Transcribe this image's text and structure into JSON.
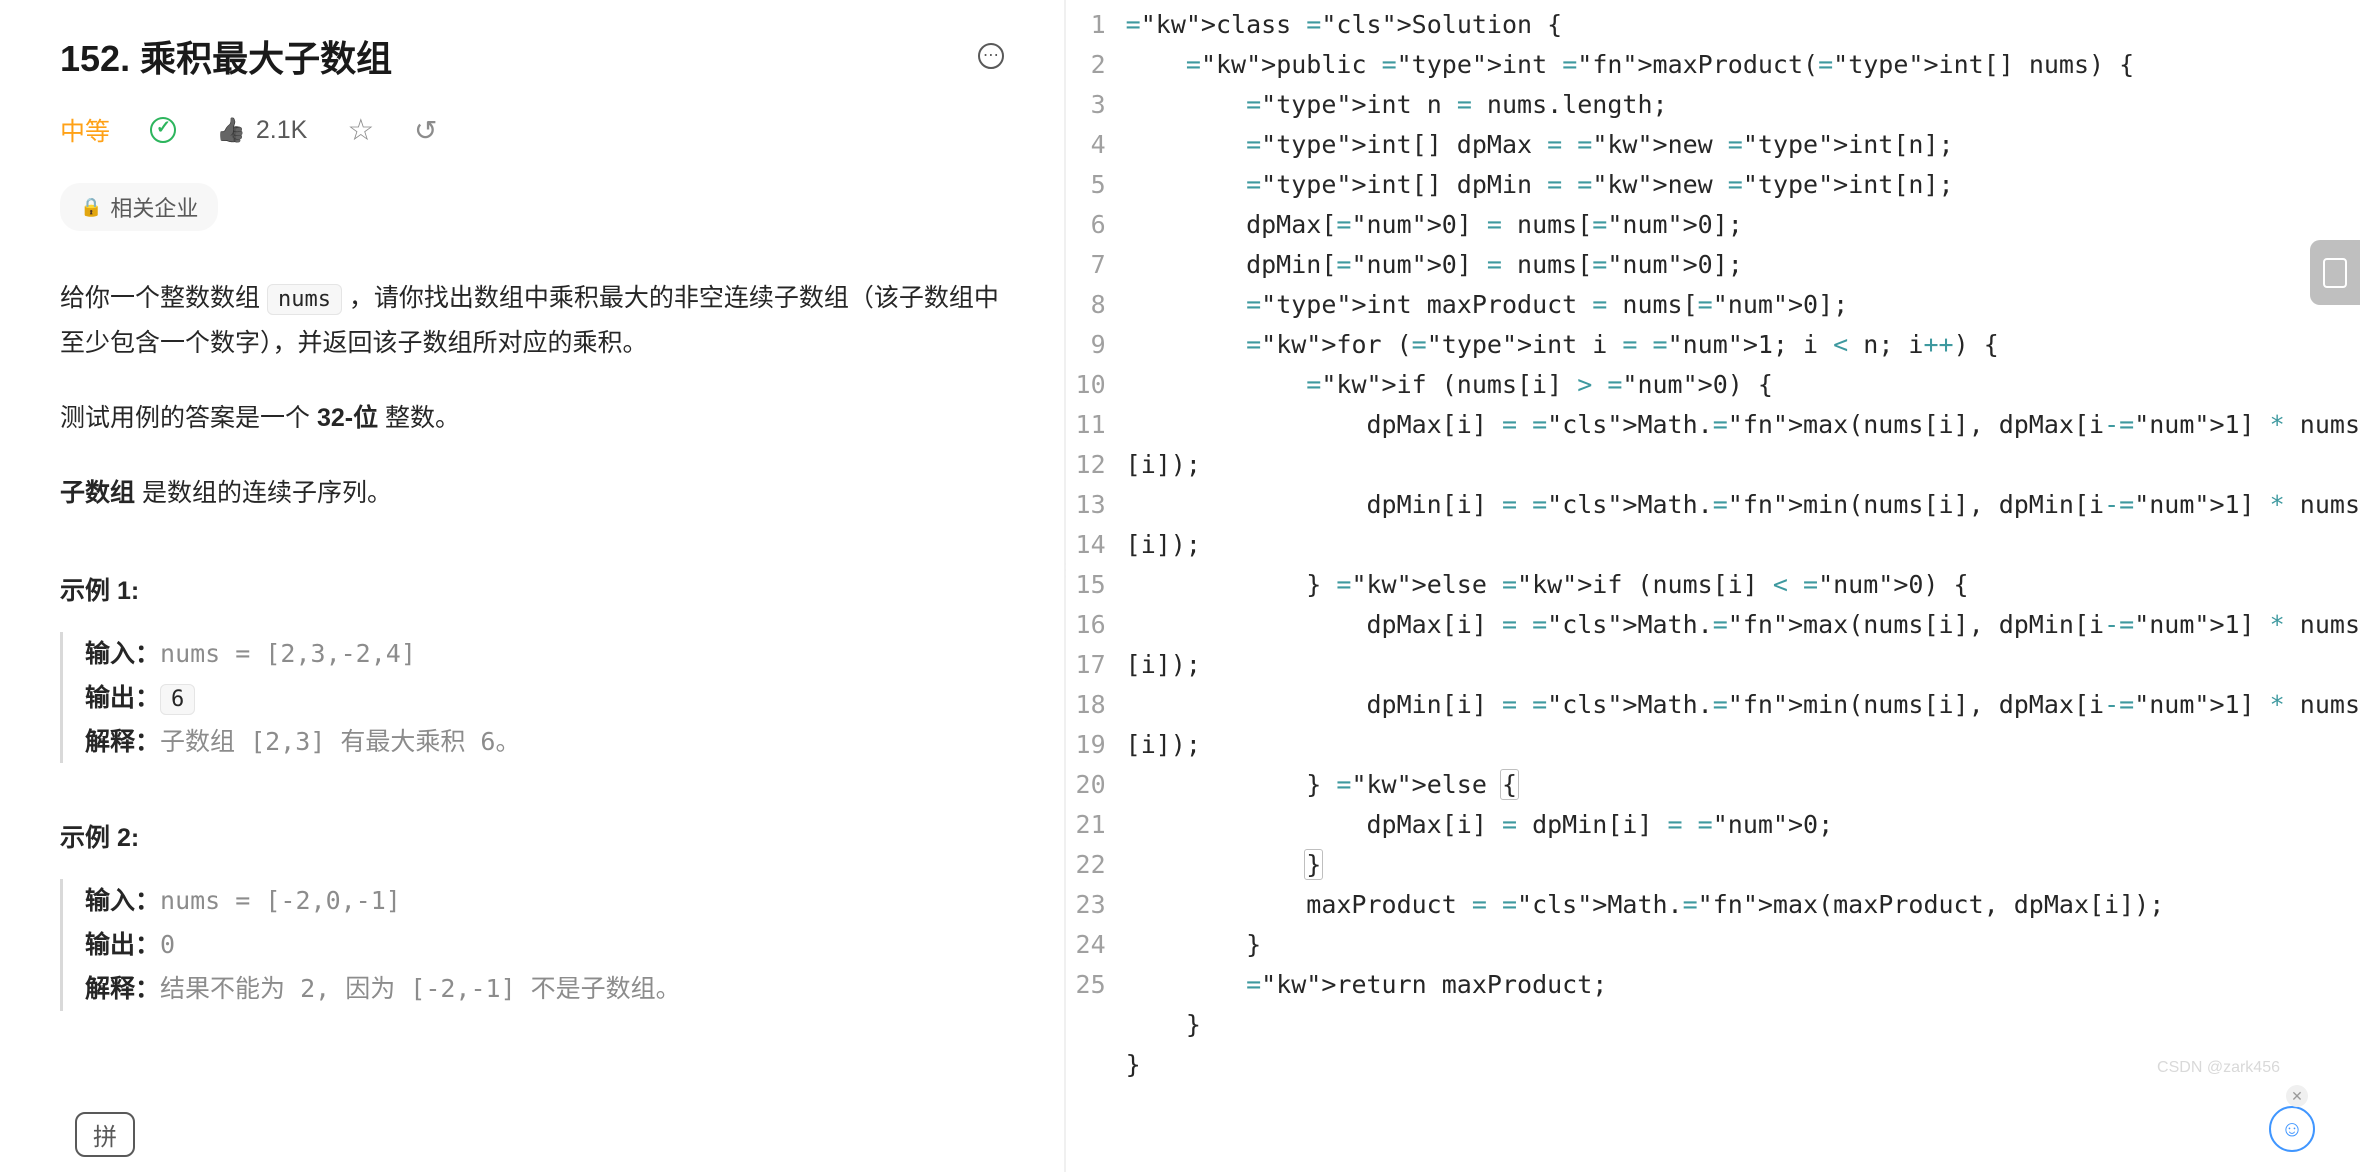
{
  "title": "152. 乘积最大子数组",
  "difficulty": "中等",
  "likes": "2.1K",
  "company_tag": "相关企业",
  "description": {
    "p1_before": "给你一个整数数组 ",
    "p1_code": "nums",
    "p1_after": " ，请你找出数组中乘积最大的非空连续子数组（该子数组中至少包含一个数字），并返回该子数组所对应的乘积。",
    "p2_before": "测试用例的答案是一个 ",
    "p2_bold": "32-位",
    "p2_after": " 整数。",
    "p3_bold": "子数组",
    "p3_after": " 是数组的连续子序列。"
  },
  "examples": [
    {
      "title": "示例 1:",
      "input_label": "输入：",
      "input": "nums = [2,3,-2,4]",
      "output_label": "输出：",
      "output": "6",
      "explain_label": "解释：",
      "explain": "子数组 [2,3] 有最大乘积 6。"
    },
    {
      "title": "示例 2:",
      "input_label": "输入：",
      "input": "nums = [-2,0,-1]",
      "output_label": "输出：",
      "output": "0",
      "explain_label": "解释：",
      "explain": "结果不能为 2, 因为 [-2,-1] 不是子数组。"
    }
  ],
  "code_lines": [
    "class Solution {",
    "    public int maxProduct(int[] nums) {",
    "        int n = nums.length;",
    "        int[] dpMax = new int[n];",
    "        int[] dpMin = new int[n];",
    "        dpMax[0] = nums[0];",
    "        dpMin[0] = nums[0];",
    "        int maxProduct = nums[0];",
    "",
    "        for (int i = 1; i < n; i++) {",
    "            if (nums[i] > 0) {",
    "                dpMax[i] = Math.max(nums[i], dpMax[i-1] * nums",
    "[i]);",
    "                dpMin[i] = Math.min(nums[i], dpMin[i-1] * nums",
    "[i]);",
    "            } else if (nums[i] < 0) {",
    "                dpMax[i] = Math.max(nums[i], dpMin[i-1] * nums",
    "[i]);",
    "                dpMin[i] = Math.min(nums[i], dpMax[i-1] * nums",
    "[i]);",
    "            } else {",
    "                dpMax[i] = dpMin[i] = 0;",
    "            }",
    "            maxProduct = Math.max(maxProduct, dpMax[i]);",
    "        }",
    "",
    "        return maxProduct;",
    "    }",
    "}"
  ],
  "line_numbers": [
    1,
    2,
    3,
    4,
    5,
    6,
    7,
    8,
    9,
    10,
    11,
    12,
    null,
    13,
    null,
    14,
    15,
    null,
    16,
    null,
    17,
    18,
    19,
    20,
    21,
    22,
    23,
    24,
    25
  ],
  "highlighted_line_index": 21,
  "ime": "拼",
  "watermark": "CSDN @zark456"
}
